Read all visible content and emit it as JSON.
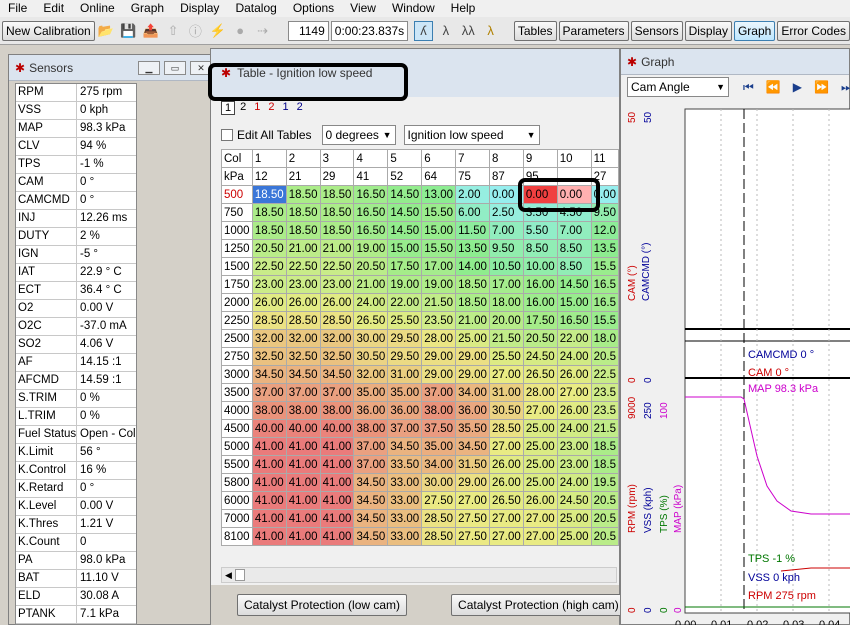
{
  "menu": [
    "File",
    "Edit",
    "Online",
    "Graph",
    "Display",
    "Datalog",
    "Options",
    "View",
    "Window",
    "Help"
  ],
  "toolbar": {
    "new_calibration": "New Calibration",
    "counter": "1149",
    "time": "0:00:23.837s",
    "buttons": [
      "Tables",
      "Parameters",
      "Sensors",
      "Display",
      "Graph",
      "Error Codes"
    ],
    "active_button": "Graph"
  },
  "sensors": {
    "title": "Sensors",
    "rows": [
      {
        "name": "RPM",
        "value": "275 rpm"
      },
      {
        "name": "VSS",
        "value": "0 kph"
      },
      {
        "name": "MAP",
        "value": "98.3 kPa"
      },
      {
        "name": "CLV",
        "value": "94 %"
      },
      {
        "name": "TPS",
        "value": "-1 %"
      },
      {
        "name": "CAM",
        "value": "0 °"
      },
      {
        "name": "CAMCMD",
        "value": "0 °"
      },
      {
        "name": "INJ",
        "value": "12.26 ms"
      },
      {
        "name": "DUTY",
        "value": "2 %"
      },
      {
        "name": "IGN",
        "value": "-5 °"
      },
      {
        "name": "IAT",
        "value": "22.9 ° C"
      },
      {
        "name": "ECT",
        "value": "36.4 ° C"
      },
      {
        "name": "O2",
        "value": "0.00 V"
      },
      {
        "name": "O2C",
        "value": "-37.0 mA"
      },
      {
        "name": "SO2",
        "value": "4.06 V"
      },
      {
        "name": "AF",
        "value": "14.15 :1"
      },
      {
        "name": "AFCMD",
        "value": "14.59 :1"
      },
      {
        "name": "S.TRIM",
        "value": "0 %"
      },
      {
        "name": "L.TRIM",
        "value": "0 %"
      },
      {
        "name": "Fuel Status",
        "value": "Open - Cold"
      },
      {
        "name": "K.Limit",
        "value": "56 °"
      },
      {
        "name": "K.Control",
        "value": "16 %"
      },
      {
        "name": "K.Retard",
        "value": "0 °"
      },
      {
        "name": "K.Level",
        "value": "0.00 V"
      },
      {
        "name": "K.Thres",
        "value": "1.21 V"
      },
      {
        "name": "K.Count",
        "value": "0"
      },
      {
        "name": "PA",
        "value": "98.0 kPa"
      },
      {
        "name": "BAT",
        "value": "11.10 V"
      },
      {
        "name": "ELD",
        "value": "30.08 A"
      },
      {
        "name": "PTANK",
        "value": "7.1 kPa"
      }
    ]
  },
  "table_window": {
    "title": "Table - Ignition low speed",
    "tab_labels": [
      "1",
      "2",
      "1",
      "2",
      "1",
      "2"
    ],
    "edit_all": "Edit All Tables",
    "degrees_select": "0 degrees",
    "table_select": "Ignition low speed",
    "col_label": "Col",
    "kpa_label": "kPa",
    "col_numbers": [
      "1",
      "2",
      "3",
      "4",
      "5",
      "6",
      "7",
      "8",
      "9",
      "10",
      "11"
    ],
    "kpa_values": [
      "12",
      "21",
      "29",
      "41",
      "52",
      "64",
      "75",
      "87",
      "95",
      "",
      "27"
    ],
    "rows": [
      {
        "rpm": "500",
        "cells": [
          "18.50",
          "18.50",
          "18.50",
          "16.50",
          "14.50",
          "13.00",
          "2.00",
          "0.00",
          "0.00",
          "0.00",
          "0.00"
        ]
      },
      {
        "rpm": "750",
        "cells": [
          "18.50",
          "18.50",
          "18.50",
          "16.50",
          "14.50",
          "15.50",
          "6.00",
          "2.50",
          "3.50",
          "4.50",
          "9.50"
        ]
      },
      {
        "rpm": "1000",
        "cells": [
          "18.50",
          "18.50",
          "18.50",
          "16.50",
          "14.50",
          "15.00",
          "11.50",
          "7.00",
          "5.50",
          "7.00",
          "12.0"
        ]
      },
      {
        "rpm": "1250",
        "cells": [
          "20.50",
          "21.00",
          "21.00",
          "19.00",
          "15.00",
          "15.50",
          "13.50",
          "9.50",
          "8.50",
          "8.50",
          "13.5"
        ]
      },
      {
        "rpm": "1500",
        "cells": [
          "22.50",
          "22.50",
          "22.50",
          "20.50",
          "17.50",
          "17.00",
          "14.00",
          "10.50",
          "10.00",
          "8.50",
          "15.5"
        ]
      },
      {
        "rpm": "1750",
        "cells": [
          "23.00",
          "23.00",
          "23.00",
          "21.00",
          "19.00",
          "19.00",
          "18.50",
          "17.00",
          "16.00",
          "14.50",
          "16.5"
        ]
      },
      {
        "rpm": "2000",
        "cells": [
          "26.00",
          "26.00",
          "26.00",
          "24.00",
          "22.00",
          "21.50",
          "18.50",
          "18.00",
          "16.00",
          "15.00",
          "16.5"
        ]
      },
      {
        "rpm": "2250",
        "cells": [
          "28.50",
          "28.50",
          "28.50",
          "26.50",
          "25.50",
          "23.50",
          "21.00",
          "20.00",
          "17.50",
          "16.50",
          "15.5"
        ]
      },
      {
        "rpm": "2500",
        "cells": [
          "32.00",
          "32.00",
          "32.00",
          "30.00",
          "29.50",
          "28.00",
          "25.00",
          "21.50",
          "20.50",
          "22.00",
          "18.0"
        ]
      },
      {
        "rpm": "2750",
        "cells": [
          "32.50",
          "32.50",
          "32.50",
          "30.50",
          "29.50",
          "29.00",
          "29.00",
          "25.50",
          "24.50",
          "24.00",
          "20.5"
        ]
      },
      {
        "rpm": "3000",
        "cells": [
          "34.50",
          "34.50",
          "34.50",
          "32.00",
          "31.00",
          "29.00",
          "29.00",
          "27.00",
          "26.50",
          "26.00",
          "22.5"
        ]
      },
      {
        "rpm": "3500",
        "cells": [
          "37.00",
          "37.00",
          "37.00",
          "35.00",
          "35.00",
          "37.00",
          "34.00",
          "31.00",
          "28.00",
          "27.00",
          "23.5"
        ]
      },
      {
        "rpm": "4000",
        "cells": [
          "38.00",
          "38.00",
          "38.00",
          "36.00",
          "36.00",
          "38.00",
          "36.00",
          "30.50",
          "27.00",
          "26.00",
          "23.5"
        ]
      },
      {
        "rpm": "4500",
        "cells": [
          "40.00",
          "40.00",
          "40.00",
          "38.00",
          "37.00",
          "37.50",
          "35.50",
          "28.50",
          "25.00",
          "24.00",
          "21.5"
        ]
      },
      {
        "rpm": "5000",
        "cells": [
          "41.00",
          "41.00",
          "41.00",
          "37.00",
          "34.50",
          "35.00",
          "34.50",
          "27.00",
          "25.00",
          "23.00",
          "18.5"
        ]
      },
      {
        "rpm": "5500",
        "cells": [
          "41.00",
          "41.00",
          "41.00",
          "37.00",
          "33.50",
          "34.00",
          "31.50",
          "26.00",
          "25.00",
          "23.00",
          "18.5"
        ]
      },
      {
        "rpm": "5800",
        "cells": [
          "41.00",
          "41.00",
          "41.00",
          "34.50",
          "33.00",
          "30.00",
          "29.00",
          "26.00",
          "25.00",
          "24.00",
          "19.5"
        ]
      },
      {
        "rpm": "6000",
        "cells": [
          "41.00",
          "41.00",
          "41.00",
          "34.50",
          "33.00",
          "27.50",
          "27.00",
          "26.50",
          "26.00",
          "24.50",
          "20.5"
        ]
      },
      {
        "rpm": "7000",
        "cells": [
          "41.00",
          "41.00",
          "41.00",
          "34.50",
          "33.00",
          "28.50",
          "27.50",
          "27.00",
          "27.00",
          "25.00",
          "20.5"
        ]
      },
      {
        "rpm": "8100",
        "cells": [
          "41.00",
          "41.00",
          "41.00",
          "34.50",
          "33.00",
          "28.50",
          "27.50",
          "27.00",
          "27.00",
          "25.00",
          "20.5"
        ]
      }
    ],
    "bottom_buttons": [
      "Catalyst Protection (low cam)",
      "Catalyst Protection (high cam)"
    ]
  },
  "graph_window": {
    "title": "Graph",
    "select": "Cam Angle",
    "top_axis_labels": [
      "CAM (°)",
      "CAMCMD (°)"
    ],
    "top_values": [
      "CAMCMD 0 °",
      "CAM 0 °"
    ],
    "top_ticks": [
      "50",
      "50",
      "0",
      "0"
    ],
    "map_label": "MAP 98.3 kPa",
    "mid_ticks": [
      "9000",
      "250",
      "100"
    ],
    "bottom_axis_labels": [
      "RPM (rpm)",
      "VSS (kph)",
      "TPS (%)",
      "MAP (kPa)"
    ],
    "bottom_values": [
      "TPS -1 %",
      "VSS 0 kph",
      "RPM 275 rpm"
    ],
    "bottom_ticks": [
      "0",
      "0",
      "0",
      "0"
    ],
    "x_ticks": [
      "0.00",
      "0.01",
      "0.02",
      "0.03",
      "0.04"
    ]
  },
  "colors": {
    "cam": "#cc0000",
    "camcmd": "#000099",
    "map": "#cc00cc",
    "tps": "#007700",
    "vss": "#000099",
    "rpm": "#cc0000"
  }
}
